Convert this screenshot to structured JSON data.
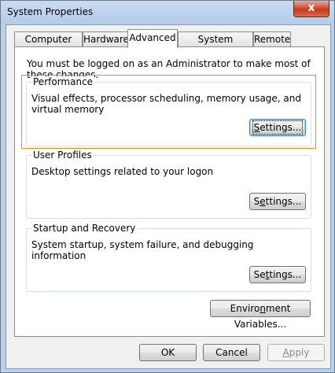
{
  "window": {
    "title": "System Properties",
    "close_glyph": "x"
  },
  "tabs": [
    {
      "label": "Computer Name",
      "active": false
    },
    {
      "label": "Hardware",
      "active": false
    },
    {
      "label": "Advanced",
      "active": true
    },
    {
      "label": "System Protection",
      "active": false
    },
    {
      "label": "Remote",
      "active": false
    }
  ],
  "notice": "You must be logged on as an Administrator to make most of these changes.",
  "groups": {
    "performance": {
      "title": "Performance",
      "description": "Visual effects, processor scheduling, memory usage, and virtual memory",
      "button": {
        "pre": "",
        "accel": "S",
        "post": "ettings..."
      }
    },
    "user_profiles": {
      "title": "User Profiles",
      "description": "Desktop settings related to your logon",
      "button": {
        "pre": "S",
        "accel": "e",
        "post": "ttings..."
      }
    },
    "startup_recovery": {
      "title": "Startup and Recovery",
      "description": "System startup, system failure, and debugging information",
      "button": {
        "pre": "Se",
        "accel": "t",
        "post": "tings..."
      }
    }
  },
  "env_button": {
    "pre": "Enviro",
    "accel": "n",
    "post": "ment Variables..."
  },
  "footer": {
    "ok": "OK",
    "cancel": "Cancel",
    "apply": {
      "pre": "",
      "accel": "A",
      "post": "pply",
      "enabled": false
    }
  },
  "colors": {
    "focus_outline": "#e8891f",
    "close_button": "#c23a1f",
    "window_frame": "#b9d1ea"
  }
}
